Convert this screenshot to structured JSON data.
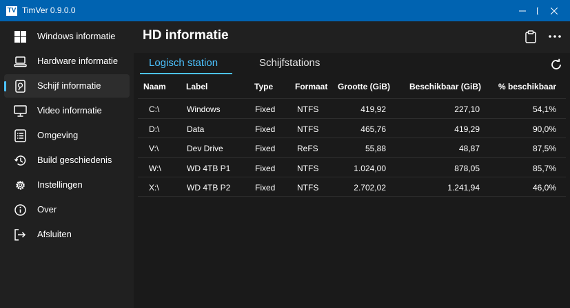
{
  "window": {
    "app_icon_text": "TV",
    "title": "TimVer  0.9.0.0"
  },
  "sidebar": {
    "items": [
      {
        "label": "Windows informatie",
        "icon": "windows-logo-icon"
      },
      {
        "label": "Hardware informatie",
        "icon": "laptop-icon"
      },
      {
        "label": "Schijf informatie",
        "icon": "disk-icon",
        "selected": true
      },
      {
        "label": "Video informatie",
        "icon": "monitor-icon"
      },
      {
        "label": "Omgeving",
        "icon": "list-icon"
      },
      {
        "label": "Build geschiedenis",
        "icon": "history-icon"
      },
      {
        "label": "Instellingen",
        "icon": "gear-icon"
      },
      {
        "label": "Over",
        "icon": "info-icon"
      },
      {
        "label": "Afsluiten",
        "icon": "exit-icon"
      }
    ]
  },
  "header": {
    "title": "HD informatie"
  },
  "tabs": [
    {
      "label": "Logisch station",
      "active": true
    },
    {
      "label": "Schijfstations",
      "active": false
    }
  ],
  "table": {
    "columns": [
      "Naam",
      "Label",
      "Type",
      "Formaat",
      "Grootte (GiB)",
      "Beschikbaar (GiB)",
      "% beschikbaar"
    ],
    "rows": [
      [
        "C:\\",
        "Windows",
        "Fixed",
        "NTFS",
        "419,92",
        "227,10",
        "54,1%"
      ],
      [
        "D:\\",
        "Data",
        "Fixed",
        "NTFS",
        "465,76",
        "419,29",
        "90,0%"
      ],
      [
        "V:\\",
        "Dev Drive",
        "Fixed",
        "ReFS",
        "55,88",
        "48,87",
        "87,5%"
      ],
      [
        "W:\\",
        "WD 4TB P1",
        "Fixed",
        "NTFS",
        "1.024,00",
        "878,05",
        "85,7%"
      ],
      [
        "X:\\",
        "WD 4TB P2",
        "Fixed",
        "NTFS",
        "2.702,02",
        "1.241,94",
        "46,0%"
      ]
    ]
  },
  "colors": {
    "accent": "#4cc2ff",
    "titlebar": "#0063b1",
    "sidebar": "#202020",
    "content": "#1a1a1a"
  }
}
